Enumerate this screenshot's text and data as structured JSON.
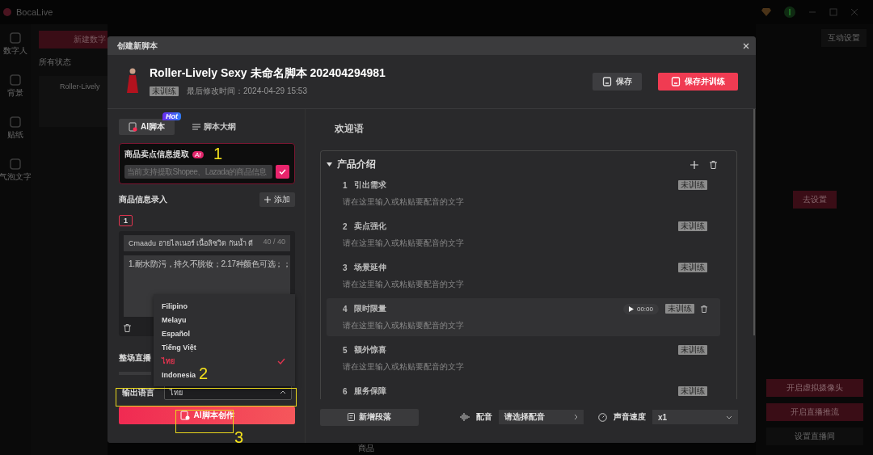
{
  "app": {
    "name": "BocaLive",
    "sidebar": [
      {
        "label": "数字人"
      },
      {
        "label": "背景"
      },
      {
        "label": "贴纸"
      },
      {
        "label": "气泡文字"
      }
    ],
    "new_button": "新建数字",
    "filter": "所有状态",
    "avatar_name": "Roller-Lively",
    "interaction_button": "互动设置",
    "setup_button": "去设置",
    "actions": [
      "开启虚拟摄像头",
      "开启直播推流",
      "设置直播间"
    ],
    "goods_label": "商品"
  },
  "dialog": {
    "title": "创建新脚本",
    "script": {
      "name": "Roller-Lively Sexy 未命名脚本 202404294981",
      "status": "未训练",
      "modified": "最后修改时间：2024-04-29 15:53"
    },
    "buttons": [
      {
        "label": "保存",
        "kind": "secondary"
      },
      {
        "label": "保存并训练",
        "kind": "primary"
      }
    ],
    "tabs": [
      {
        "label": "AI脚本",
        "selected": true,
        "badge": "Hot"
      },
      {
        "label": "脚本大纲",
        "selected": false
      }
    ],
    "extract": {
      "title": "商品卖点信息提取",
      "badge": "AI",
      "placeholder": "当前支持提取Shopee、Lazada的商品信息"
    },
    "products": {
      "title": "商品信息录入",
      "add_button": "添加",
      "items": [
        {
          "number": "1",
          "name": "Cmaadu อายไลเนอร์ เนื้อลิซวิด กันน้ำ ดี",
          "count": "40 / 40",
          "description": "1.耐水防污，持久不脱妆；2.17种颜色可选；；"
        }
      ]
    },
    "live_label": "整场直播",
    "language": {
      "label": "输出语言",
      "value": "ไทย",
      "expanded": true,
      "options": [
        {
          "label": "Filipino",
          "selected": false
        },
        {
          "label": "Melayu",
          "selected": false
        },
        {
          "label": "Español",
          "selected": false
        },
        {
          "label": "Tiếng Việt",
          "selected": false
        },
        {
          "label": "ไทย",
          "selected": true
        },
        {
          "label": "Indonesia",
          "selected": false
        }
      ]
    },
    "create_button": "AI脚本创作",
    "welcome": "欢迎语",
    "section": {
      "title": "产品介绍",
      "expanded": true,
      "paragraphs": [
        {
          "number": "1",
          "title": "引出需求",
          "placeholder": "请在这里输入或粘贴要配音的文字",
          "status": "未训练",
          "hovered": false
        },
        {
          "number": "2",
          "title": "卖点强化",
          "placeholder": "请在这里输入或粘贴要配音的文字",
          "status": "未训练",
          "hovered": false
        },
        {
          "number": "3",
          "title": "场景延伸",
          "placeholder": "请在这里输入或粘贴要配音的文字",
          "status": "未训练",
          "hovered": false
        },
        {
          "number": "4",
          "title": "限时限量",
          "placeholder": "请在这里输入或粘贴要配音的文字",
          "status": "未训练",
          "hovered": true,
          "duration": "00:00"
        },
        {
          "number": "5",
          "title": "额外惊喜",
          "placeholder": "请在这里输入或粘贴要配音的文字",
          "status": "未训练",
          "hovered": false
        },
        {
          "number": "6",
          "title": "服务保障",
          "status": "未训练",
          "hovered": false
        }
      ]
    },
    "footer": {
      "add_paragraph": "新增段落",
      "voice_label": "配音",
      "voice_placeholder": "请选择配音",
      "speed_label": "声音速度",
      "speed_value": "x1"
    }
  },
  "annotations": [
    {
      "label": "1",
      "boxed": false
    },
    {
      "label": "2",
      "boxed": true
    },
    {
      "label": "3",
      "boxed": true
    }
  ]
}
